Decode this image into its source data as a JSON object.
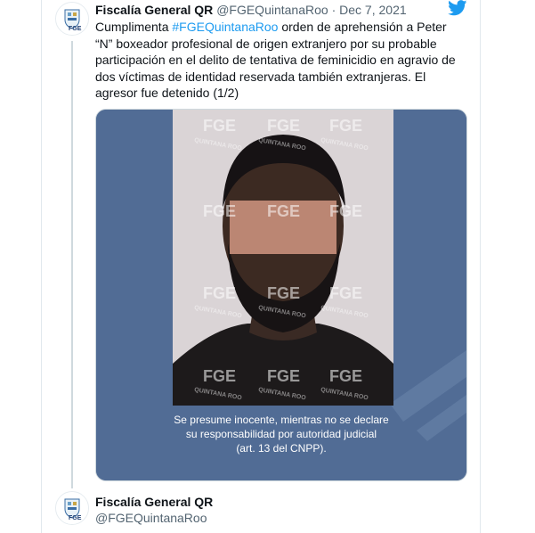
{
  "tweet1": {
    "name": "Fiscalía General QR",
    "handle": "@FGEQuintanaRoo",
    "separator": "·",
    "date": "Dec 7, 2021",
    "text_before": "Cumplimenta ",
    "hashtag": "#FGEQuintanaRoo",
    "text_after": " orden de aprehensión a Peter “N” boxeador profesional de origen extranjero por su probable participación en el delito de tentativa de feminicidio en agravio de dos víctimas de identidad reservada también extranjeras. El agresor fue detenido (1/2)"
  },
  "media": {
    "watermark": "FGE",
    "watermark_sub": "QUINTANA ROO",
    "caption_lines": [
      "Se presume inocente, mientras no se declare",
      "su responsabilidad por autoridad judicial",
      "(art. 13 del CNPP)."
    ],
    "background_color": "#516c95"
  },
  "tweet2": {
    "name": "Fiscalía General QR",
    "handle": "@FGEQuintanaRoo"
  },
  "avatar": {
    "label": "FGE"
  },
  "colors": {
    "link": "#1d9bf0",
    "twitter": "#1d9bf0"
  }
}
